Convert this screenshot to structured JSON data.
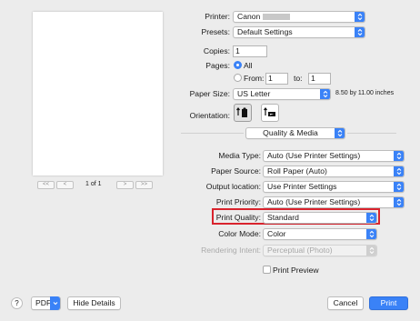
{
  "preview": {
    "page_counter": "1 of 1"
  },
  "printer": {
    "label": "Printer:",
    "value": "Canon"
  },
  "presets": {
    "label": "Presets:",
    "value": "Default Settings"
  },
  "copies": {
    "label": "Copies:",
    "value": "1"
  },
  "pages": {
    "label": "Pages:",
    "all_label": "All",
    "from_label": "From:",
    "from_value": "1",
    "to_label": "to:",
    "to_value": "1"
  },
  "paper_size": {
    "label": "Paper Size:",
    "value": "US Letter",
    "dimensions": "8.50 by 11.00 inches"
  },
  "orientation": {
    "label": "Orientation:"
  },
  "section": {
    "value": "Quality & Media"
  },
  "media_type": {
    "label": "Media Type:",
    "value": "Auto (Use Printer Settings)"
  },
  "paper_source": {
    "label": "Paper Source:",
    "value": "Roll Paper (Auto)"
  },
  "output_location": {
    "label": "Output location:",
    "value": "Use Printer Settings"
  },
  "print_priority": {
    "label": "Print Priority:",
    "value": "Auto (Use Printer Settings)"
  },
  "print_quality": {
    "label": "Print Quality:",
    "value": "Standard"
  },
  "color_mode": {
    "label": "Color Mode:",
    "value": "Color"
  },
  "rendering_intent": {
    "label": "Rendering Intent:",
    "value": "Perceptual (Photo)"
  },
  "print_preview": {
    "label": "Print Preview"
  },
  "footer": {
    "help": "?",
    "pdf": "PDF",
    "hide_details": "Hide Details",
    "cancel": "Cancel",
    "print": "Print"
  },
  "colors": {
    "accent": "#3a82f7",
    "highlight": "#d9232d"
  }
}
